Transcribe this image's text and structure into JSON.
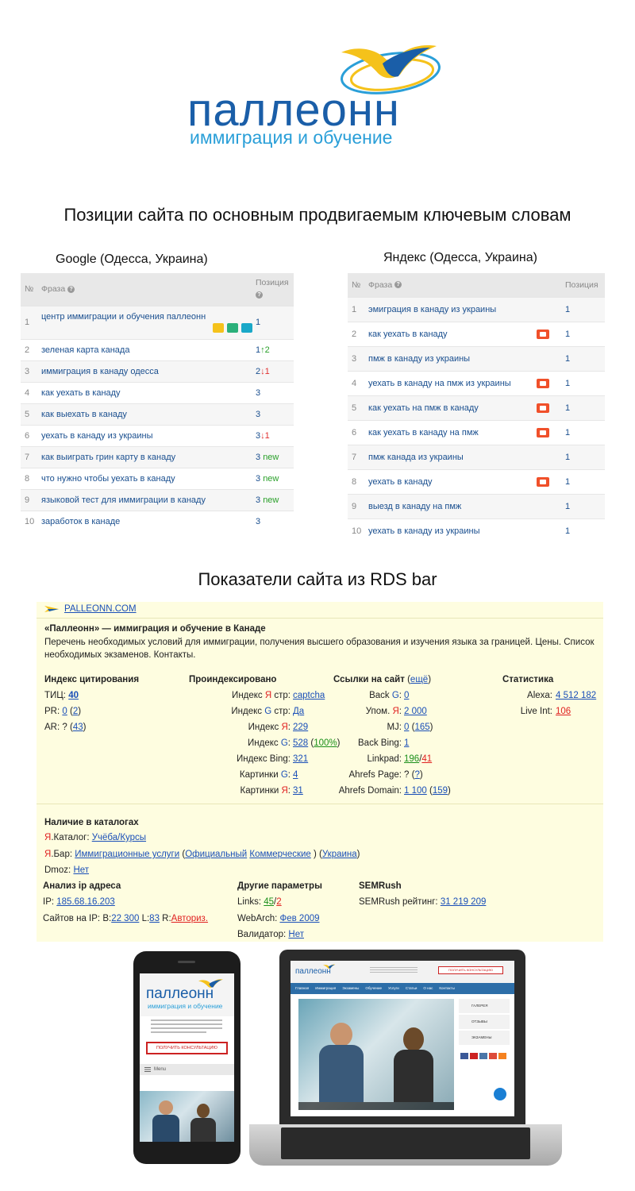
{
  "logo": {
    "word": "паллеонн",
    "tagline": "иммиграция и обучение"
  },
  "headings": {
    "positions": "Позиции сайта по основным продвигаемым ключевым словам",
    "rds": "Показатели сайта из RDS bar"
  },
  "google": {
    "title": "Google (Одесса, Украина)",
    "col_num": "№",
    "col_phrase": "Фраза",
    "col_pos": "Позиция",
    "rows": [
      {
        "n": "1",
        "phrase": "центр иммиграции и обучения паллеонн",
        "pos": "1",
        "delta": "",
        "dir": ""
      },
      {
        "n": "2",
        "phrase": "зеленая карта канада",
        "pos": "1",
        "delta": "2",
        "dir": "up"
      },
      {
        "n": "3",
        "phrase": "иммиграция в канаду одесса",
        "pos": "2",
        "delta": "1",
        "dir": "down"
      },
      {
        "n": "4",
        "phrase": "как уехать в канаду",
        "pos": "3",
        "delta": "",
        "dir": ""
      },
      {
        "n": "5",
        "phrase": "как выехать в канаду",
        "pos": "3",
        "delta": "",
        "dir": ""
      },
      {
        "n": "6",
        "phrase": "уехать в канаду из украины",
        "pos": "3",
        "delta": "1",
        "dir": "down"
      },
      {
        "n": "7",
        "phrase": "как выиграть грин карту в канаду",
        "pos": "3",
        "delta": "new",
        "dir": "new"
      },
      {
        "n": "8",
        "phrase": "что нужно чтобы уехать в канаду",
        "pos": "3",
        "delta": "new",
        "dir": "new"
      },
      {
        "n": "9",
        "phrase": "языковой тест для иммиграции в канаду",
        "pos": "3",
        "delta": "new",
        "dir": "new"
      },
      {
        "n": "10",
        "phrase": "заработок в канаде",
        "pos": "3",
        "delta": "",
        "dir": ""
      }
    ]
  },
  "yandex": {
    "title": "Яндекс (Одесса, Украина)",
    "col_num": "№",
    "col_phrase": "Фраза",
    "col_pos": "Позиция",
    "rows": [
      {
        "n": "1",
        "phrase": "эмиграция в канаду из украины",
        "pos": "1",
        "video": false
      },
      {
        "n": "2",
        "phrase": "как уехать в канаду",
        "pos": "1",
        "video": true
      },
      {
        "n": "3",
        "phrase": "пмж в канаду из украины",
        "pos": "1",
        "video": false
      },
      {
        "n": "4",
        "phrase": "уехать в канаду на пмж из украины",
        "pos": "1",
        "video": true
      },
      {
        "n": "5",
        "phrase": "как уехать на пмж в канаду",
        "pos": "1",
        "video": true
      },
      {
        "n": "6",
        "phrase": "как уехать в канаду на пмж",
        "pos": "1",
        "video": true
      },
      {
        "n": "7",
        "phrase": "пмж канада из украины",
        "pos": "1",
        "video": false
      },
      {
        "n": "8",
        "phrase": "уехать в канаду",
        "pos": "1",
        "video": true
      },
      {
        "n": "9",
        "phrase": "выезд в канаду на пмж",
        "pos": "1",
        "video": false
      },
      {
        "n": "10",
        "phrase": "уехать в канаду из украины",
        "pos": "1",
        "video": false
      }
    ]
  },
  "rds": {
    "domain": "PALLEONN.COM",
    "site_title": "«Паллеонн» — иммиграция и обучение в Канаде",
    "desc1": "Перечень необходимых условий для иммиграции, получения высшего образования и изучения языка за границей. Цены. Список",
    "desc2": "необходимых экзаменов. Контакты.",
    "citation": {
      "title": "Индекс цитирования",
      "tic_label": "ТИЦ:",
      "tic": "40",
      "pr_label": "PR:",
      "pr_a": "0",
      "pr_b": "2",
      "ar_label": "AR:",
      "ar_a": "?",
      "ar_b": "43"
    },
    "indexed": {
      "title": "Проиндексировано",
      "r1_pre": "Индекс ",
      "r1_mark": "Я",
      "r1_post": " стр:",
      "r1_val": "captcha",
      "r2_pre": "Индекс ",
      "r2_mark": "G",
      "r2_post": " стр:",
      "r2_val": "Да",
      "r3_pre": "Индекс ",
      "r3_mark": "Я",
      "r3_post": ":",
      "r3_val": "229",
      "r4_pre": "Индекс ",
      "r4_mark": "G",
      "r4_post": ":",
      "r4_val": "528",
      "r4_extra": "100%",
      "r5_label": "Индекс Bing:",
      "r5_val": "321",
      "r6_pre": "Картинки ",
      "r6_mark": "G",
      "r6_post": ":",
      "r6_val": "4",
      "r7_pre": "Картинки ",
      "r7_mark": "Я",
      "r7_post": ":",
      "r7_val": "31"
    },
    "links": {
      "title": "Ссылки на сайт",
      "more": "ещё",
      "r1_pre": "Back ",
      "r1_mark": "G",
      "r1_post": ":",
      "r1_val": "0",
      "r2_pre": "Упом. ",
      "r2_mark": "Я",
      "r2_post": ":",
      "r2_val": "2 000",
      "r3_label": "MJ:",
      "r3_a": "0",
      "r3_b": "165",
      "r4_label": "Back Bing:",
      "r4_val": "1",
      "r5_label": "Linkpad:",
      "r5_a": "196",
      "r5_b": "41",
      "r6_label": "Ahrefs Page:",
      "r6_a": "?",
      "r6_b": "?",
      "r7_label": "Ahrefs Domain:",
      "r7_a": "1 100",
      "r7_b": "159"
    },
    "stats": {
      "title": "Статистика",
      "alexa_label": "Alexa:",
      "alexa": "4 512 182",
      "liveint_label": "Live Int:",
      "liveint": "106"
    },
    "catalog": {
      "title": "Наличие в каталогах",
      "ya_mark": "Я",
      "ya_label": ".Каталог:",
      "ya_val": "Учёба/Курсы",
      "bar_mark": "Я",
      "bar_label": ".Бар:",
      "bar_val": "Иммиграционные услуги",
      "bar_a": "Официальный",
      "bar_b": "Коммерческие",
      "bar_c": "Украина",
      "dmoz_label": "Dmoz:",
      "dmoz_val": "Нет"
    },
    "ip": {
      "title": "Анализ ip адреса",
      "ip_label": "IP:",
      "ip": "185.68.16.203",
      "sites_label": "Сайтов на IP:",
      "b_label": "B:",
      "b": "22 300",
      "l_label": "L:",
      "l": "83",
      "r_label": "R:",
      "r": "Авториз."
    },
    "other": {
      "title": "Другие параметры",
      "links_label": "Links:",
      "links_a": "45",
      "links_b": "2",
      "webarch_label": "WebArch:",
      "webarch": "Фев 2009",
      "valid_label": "Валидатор:",
      "valid": "Нет"
    },
    "semrush": {
      "title": "SEMRush",
      "label": "SEMRush рейтинг:",
      "val": "31 219 209"
    }
  },
  "devices": {
    "phone_logo": "паллеонн",
    "phone_tagline": "иммиграция и обучение",
    "phone_button": "ПОЛУЧИТЬ КОНСУЛЬТАЦИЮ",
    "phone_menu": "Menu",
    "laptop_logo": "паллеонн",
    "laptop_button": "ПОЛУЧИТЬ КОНСУЛЬТАЦИЮ",
    "laptop_nav": [
      "Главная",
      "Иммиграция",
      "Экзамены",
      "Обучение",
      "Услуги",
      "Статьи",
      "О нас",
      "Контакты"
    ],
    "laptop_side": [
      "ГАЛЕРЕЯ",
      "ОТЗЫВЫ",
      "ЭКЗАМЕНЫ"
    ],
    "colors": {
      "brand_blue": "#1a5ea8",
      "accent_yellow": "#f5c21b",
      "light_blue": "#2a9fd8"
    }
  }
}
